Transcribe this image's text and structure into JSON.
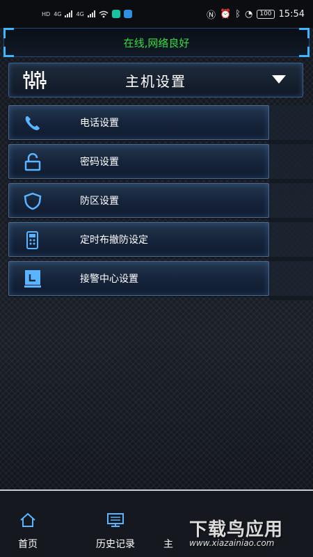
{
  "status_bar": {
    "time": "15:54",
    "battery": "100",
    "network_labels": [
      "HD",
      "4G",
      "4G"
    ]
  },
  "banner": {
    "status_text": "在线,网络良好",
    "accent": "#33dd44"
  },
  "host_settings": {
    "title": "主机设置"
  },
  "menu": {
    "items": [
      {
        "label": "电话设置",
        "icon": "phone-icon"
      },
      {
        "label": "密码设置",
        "icon": "lock-icon"
      },
      {
        "label": "防区设置",
        "icon": "shield-icon"
      },
      {
        "label": "定时布撤防设定",
        "icon": "remote-control-icon"
      },
      {
        "label": "接警中心设置",
        "icon": "monitor-icon"
      }
    ]
  },
  "bottom_nav": {
    "items": [
      {
        "label": "首页",
        "icon": "home-icon"
      },
      {
        "label": "历史记录",
        "icon": "history-icon"
      },
      {
        "label": "主",
        "icon": "host-icon"
      }
    ]
  },
  "watermark": {
    "title": "下载鸟应用",
    "url": "www.xiazainiao.com"
  }
}
